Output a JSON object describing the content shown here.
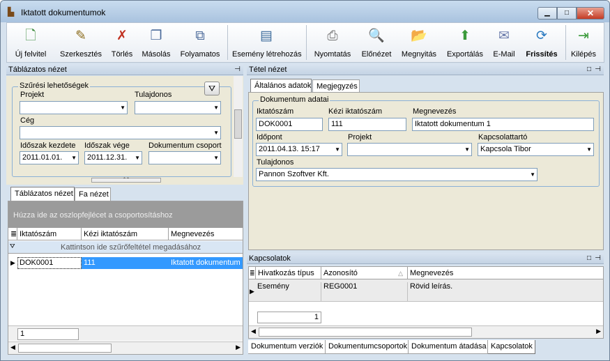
{
  "window": {
    "title": "Iktatott dokumentumok",
    "min": "▁",
    "max": "□",
    "close": "✕"
  },
  "toolbar": {
    "new": "Új felvitel",
    "edit": "Szerkesztés",
    "delete": "Törlés",
    "copy": "Másolás",
    "continuous": "Folyamatos",
    "event": "Esemény létrehozás",
    "print": "Nyomtatás",
    "preview": "Előnézet",
    "open": "Megnyitás",
    "export": "Exportálás",
    "email": "E-Mail",
    "refresh": "Frissítés",
    "exit": "Kilépés"
  },
  "left": {
    "header": "Táblázatos nézet",
    "filter": {
      "legend": "Szűrési lehetőségek",
      "projekt_label": "Projekt",
      "projekt_value": "",
      "tulajdonos_label": "Tulajdonos",
      "tulajdonos_value": "",
      "ceg_label": "Cég",
      "ceg_value": "",
      "start_label": "Időszak kezdete",
      "start_value": "2011.01.01.",
      "end_label": "Időszak vége",
      "end_value": "2011.12.31.",
      "group_label": "Dokumentum csoport",
      "group_value": ""
    },
    "tabs": [
      "Táblázatos nézet",
      "Fa nézet"
    ],
    "group_hint": "Húzza ide az oszlopfejlécet a csoportosításhoz",
    "columns": [
      "Iktatószám",
      "Kézi iktatószám",
      "Megnevezés"
    ],
    "filter_row": "Kattintson ide szűrőfeltétel megadásához",
    "rows": [
      [
        "DOK0001",
        "111",
        "Iktatott dokumentum"
      ]
    ],
    "count": "1"
  },
  "right": {
    "header": "Tétel nézet",
    "tabs": [
      "Általános adatok",
      "Megjegyzés"
    ],
    "legend": "Dokumentum adatai",
    "iktato_label": "Iktatószám",
    "iktato_value": "DOK0001",
    "kezi_label": "Kézi iktatószám",
    "kezi_value": "111",
    "megnev_label": "Megnevezés",
    "megnev_value": "Iktatott dokumentum 1",
    "idopont_label": "Időpont",
    "idopont_value": "2011.04.13. 15:17",
    "projekt_label": "Projekt",
    "projekt_value": "",
    "kapcs_label": "Kapcsolattartó",
    "kapcs_value": "Kapcsola Tibor",
    "tulaj_label": "Tulajdonos",
    "tulaj_value": "Pannon Szoftver Kft.",
    "links_header": "Kapcsolatok",
    "link_columns": [
      "Hivatkozás típus",
      "Azonosító",
      "Megnevezés"
    ],
    "link_rows": [
      [
        "Esemény",
        "REG0001",
        "Rövid leírás."
      ]
    ],
    "link_count": "1",
    "bottom_tabs": [
      "Dokumentum verziók",
      "Dokumentumcsoportok",
      "Dokumentum átadása",
      "Kapcsolatok"
    ]
  }
}
